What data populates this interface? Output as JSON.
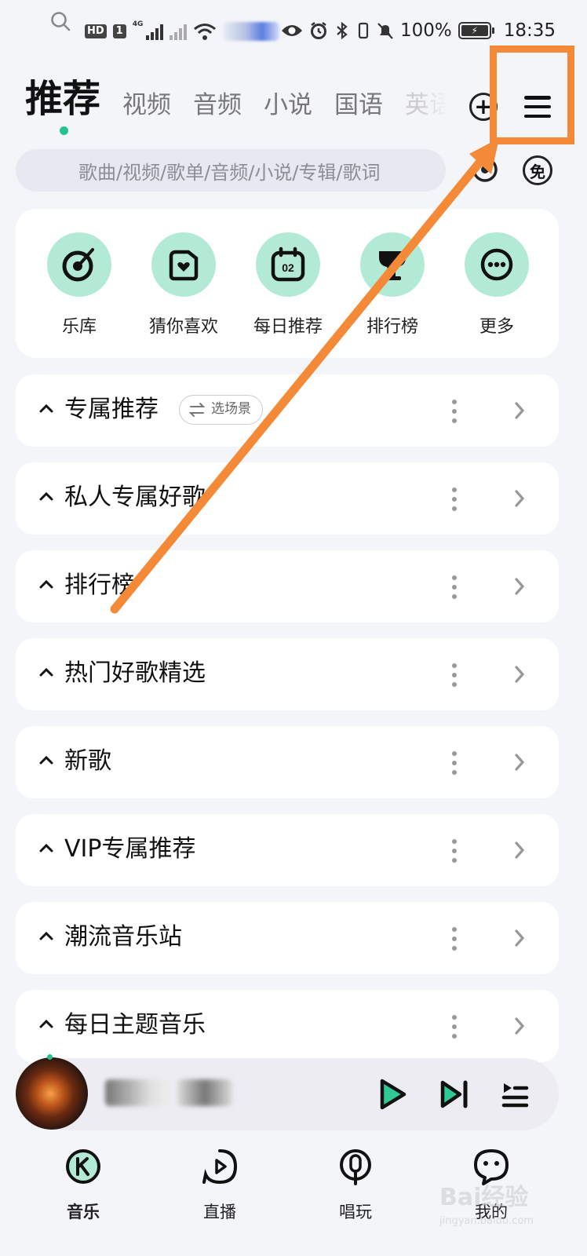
{
  "status_bar": {
    "hd": "HD",
    "sim": "1",
    "network": "4G",
    "battery": "100%",
    "time": "18:35"
  },
  "top_tabs": {
    "active": "推荐",
    "items": [
      "视频",
      "音频",
      "小说",
      "国语",
      "英语"
    ]
  },
  "search": {
    "placeholder": "歌曲/视频/歌单/音频/小说/专辑/歌词"
  },
  "free_badge": "免",
  "shortcuts": [
    {
      "label": "乐库",
      "icon": "music-disc-icon"
    },
    {
      "label": "猜你喜欢",
      "icon": "heart-radio-icon"
    },
    {
      "label": "每日推荐",
      "icon": "calendar-icon",
      "day": "02"
    },
    {
      "label": "排行榜",
      "icon": "trophy-icon"
    },
    {
      "label": "更多",
      "icon": "more-icon"
    }
  ],
  "sections": [
    {
      "title": "专属推荐",
      "chip": "选场景"
    },
    {
      "title": "私人专属好歌"
    },
    {
      "title": "排行榜"
    },
    {
      "title": "热门好歌精选"
    },
    {
      "title": "新歌"
    },
    {
      "title": "VIP专属推荐"
    },
    {
      "title": "潮流音乐站"
    },
    {
      "title": "每日主题音乐"
    }
  ],
  "bottom_nav": [
    {
      "label": "音乐",
      "icon": "k-music-icon",
      "active": true
    },
    {
      "label": "直播",
      "icon": "live-icon"
    },
    {
      "label": "唱玩",
      "icon": "microphone-icon"
    },
    {
      "label": "我的",
      "icon": "profile-icon"
    }
  ],
  "watermark": {
    "text": "Bai经验",
    "sub": "jingyan.baidu.com"
  },
  "colors": {
    "accent": "#22c38e",
    "icon_circle": "#b3ead6",
    "annotation": "#f48a37"
  }
}
